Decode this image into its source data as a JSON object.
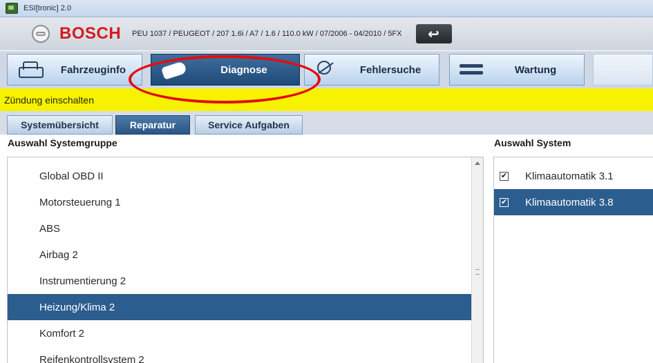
{
  "window": {
    "title": "ESI[tronic] 2.0",
    "icon": "esitronic-app-icon"
  },
  "header": {
    "brand": "BOSCH",
    "vehicle_info": "PEU 1037 / PEUGEOT / 207 1.6i / A7 / 1.6 / 110.0 kW / 07/2006 - 04/2010 / 5FX",
    "back_icon": "back-arrow-icon",
    "back_glyph": "↩"
  },
  "tabs": [
    {
      "label": "Fahrzeuginfo",
      "icon": "car-icon",
      "active": false
    },
    {
      "label": "Diagnose",
      "icon": "plug-icon",
      "active": true
    },
    {
      "label": "Fehlersuche",
      "icon": "search-icon",
      "active": false
    },
    {
      "label": "Wartung",
      "icon": "wrench-icon",
      "active": false
    },
    {
      "label": "",
      "icon": "disabled-tab-icon",
      "active": false
    }
  ],
  "status": {
    "message": "Zündung einschalten"
  },
  "subtabs": [
    {
      "label": "Systemübersicht",
      "active": false
    },
    {
      "label": "Reparatur",
      "active": true
    },
    {
      "label": "Service Aufgaben",
      "active": false
    }
  ],
  "left_panel": {
    "heading": "Auswahl Systemgruppe",
    "items": [
      "Global OBD II",
      "Motorsteuerung 1",
      "ABS",
      "Airbag 2",
      "Instrumentierung 2",
      "Heizung/Klima 2",
      "Komfort 2",
      "Reifenkontrollsystem 2"
    ],
    "selected": "Heizung/Klima 2"
  },
  "right_panel": {
    "heading": "Auswahl System",
    "items": [
      {
        "label": "Klimaautomatik 3.1",
        "checked": true,
        "selected": false
      },
      {
        "label": "Klimaautomatik 3.8",
        "checked": true,
        "selected": true
      }
    ],
    "check_glyph": "✔"
  },
  "colors": {
    "brand_red": "#d21b1f",
    "selection_blue": "#2b5d8e",
    "status_yellow": "#f7f200",
    "annotation_red": "#e20e0e"
  }
}
